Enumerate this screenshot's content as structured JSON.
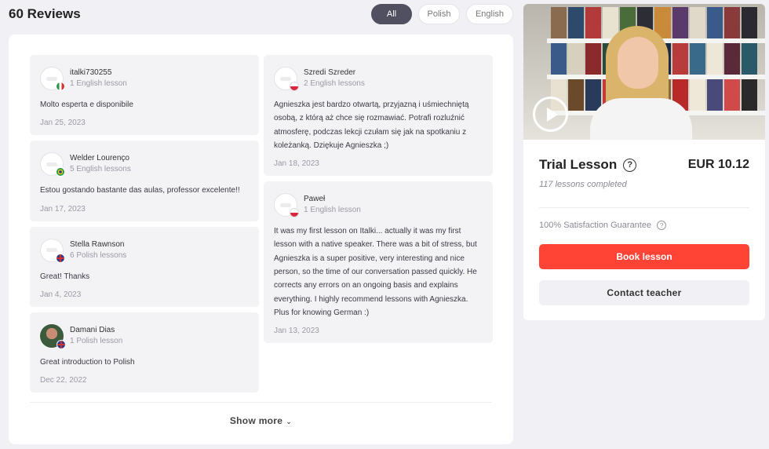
{
  "header": {
    "title": "60 Reviews"
  },
  "filters": [
    {
      "label": "All",
      "active": true
    },
    {
      "label": "Polish",
      "active": false
    },
    {
      "label": "English",
      "active": false
    }
  ],
  "reviews_left": [
    {
      "name": "italki730255",
      "lessons": "1 English lesson",
      "text": "Molto esperta e disponibile",
      "date": "Jan 25, 2023",
      "flag": "italy"
    },
    {
      "name": "Welder Lourenço",
      "lessons": "5 English lessons",
      "text": "Estou gostando bastante das aulas, professor excelente!!",
      "date": "Jan 17, 2023",
      "flag": "brazil"
    },
    {
      "name": "Stella Rawnson",
      "lessons": "6 Polish lessons",
      "text": "Great! Thanks",
      "date": "Jan 4, 2023",
      "flag": "uk"
    },
    {
      "name": "Damani Dias",
      "lessons": "1 Polish lesson",
      "text": "Great introduction to Polish",
      "date": "Dec 22, 2022",
      "flag": "uk"
    }
  ],
  "reviews_right": [
    {
      "name": "Szredi Szreder",
      "lessons": "2 English lessons",
      "text": "Agnieszka jest bardzo otwartą, przyjazną i uśmiechniętą osobą, z którą aż chce się rozmawiać. Potrafi rozluźnić atmosferę, podczas lekcji czułam się jak na spotkaniu z koleżanką. Dziękuje Agnieszka ;)",
      "date": "Jan 18, 2023",
      "flag": "poland"
    },
    {
      "name": "Paweł",
      "lessons": "1 English lesson",
      "text": "It was my first lesson on Italki... actually it was my first lesson with a native speaker. There was a bit of stress, but Agnieszka is a super positive, very interesting and nice person, so the time of our conversation passed quickly. He corrects any errors on an ongoing basis and explains everything. I highly recommend lessons with Agnieszka. Plus for knowing German :)",
      "date": "Jan 13, 2023",
      "flag": "poland"
    }
  ],
  "show_more": "Show more",
  "sidebar": {
    "trial_title": "Trial Lesson",
    "price": "EUR 10.12",
    "completed": "117 lessons completed",
    "guarantee": "100% Satisfaction Guarantee",
    "book_label": "Book lesson",
    "contact_label": "Contact teacher",
    "help_glyph": "?"
  },
  "colors": {
    "accent": "#ff4436",
    "active_pill": "#505060",
    "card_bg": "#f3f3f6"
  }
}
